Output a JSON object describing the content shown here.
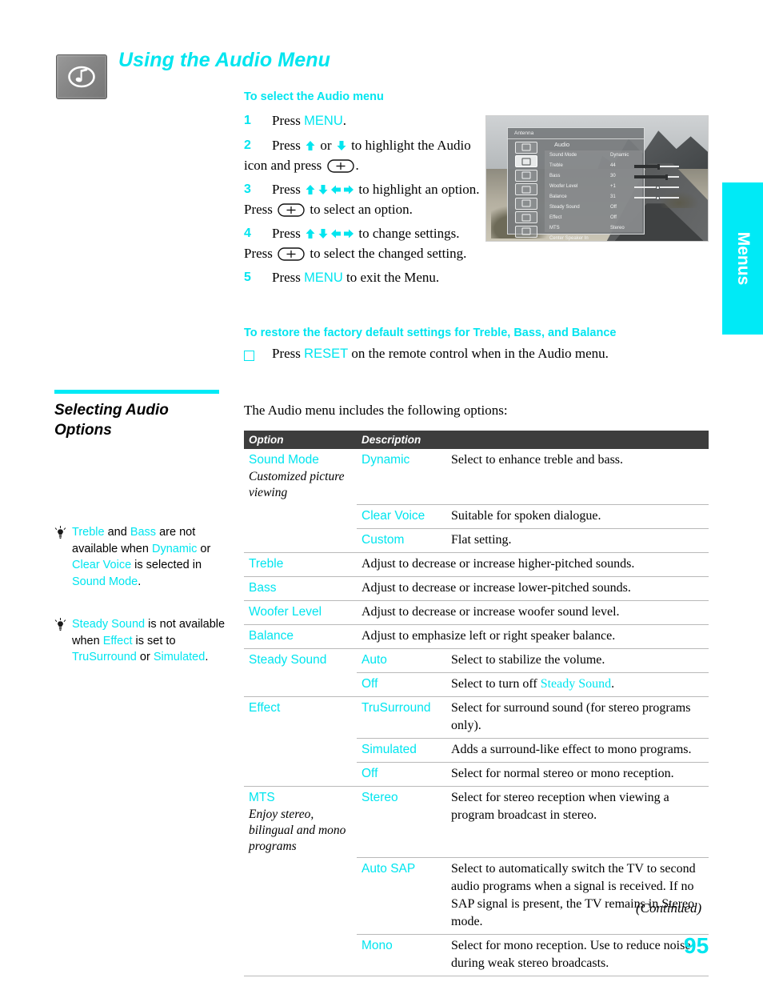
{
  "header": {
    "title": "Using the Audio Menu",
    "icon": "audio-note-icon"
  },
  "procedure": {
    "heading": "To select the Audio menu",
    "steps": [
      {
        "num": "1",
        "parts": [
          {
            "t": "text",
            "v": "Press "
          },
          {
            "t": "key",
            "v": "MENU"
          },
          {
            "t": "text",
            "v": "."
          }
        ]
      },
      {
        "num": "2",
        "parts": [
          {
            "t": "text",
            "v": "Press "
          },
          {
            "t": "arrow",
            "v": "up"
          },
          {
            "t": "text",
            "v": " or "
          },
          {
            "t": "arrow",
            "v": "down"
          },
          {
            "t": "text",
            "v": " to highlight the Audio icon and press "
          },
          {
            "t": "okbtn",
            "v": "center-enter-button"
          },
          {
            "t": "text",
            "v": "."
          }
        ]
      },
      {
        "num": "3",
        "parts": [
          {
            "t": "text",
            "v": "Press "
          },
          {
            "t": "arrow",
            "v": "up"
          },
          {
            "t": "arrow",
            "v": "down"
          },
          {
            "t": "arrow",
            "v": "left"
          },
          {
            "t": "arrow",
            "v": "right"
          },
          {
            "t": "text",
            "v": " to highlight an option. Press "
          },
          {
            "t": "okbtn",
            "v": "center-enter-button"
          },
          {
            "t": "text",
            "v": " to select an option."
          }
        ]
      },
      {
        "num": "4",
        "parts": [
          {
            "t": "text",
            "v": "Press "
          },
          {
            "t": "arrow",
            "v": "up"
          },
          {
            "t": "arrow",
            "v": "down"
          },
          {
            "t": "arrow",
            "v": "left"
          },
          {
            "t": "arrow",
            "v": "right"
          },
          {
            "t": "text",
            "v": " to change settings. Press "
          },
          {
            "t": "okbtn",
            "v": "center-enter-button"
          },
          {
            "t": "text",
            "v": " to select the changed setting."
          }
        ]
      },
      {
        "num": "5",
        "parts": [
          {
            "t": "text",
            "v": "Press "
          },
          {
            "t": "key",
            "v": "MENU"
          },
          {
            "t": "text",
            "v": " to exit the Menu."
          }
        ]
      }
    ]
  },
  "restore": {
    "heading": "To restore the factory default settings for Treble, Bass, and Balance",
    "line_pre": "Press ",
    "line_key": "RESET",
    "line_post": " on the remote control when in the Audio menu."
  },
  "tv_screen": {
    "title_bar": "Antenna",
    "menu_name": "Audio",
    "rows": [
      {
        "label": "Sound Mode",
        "value": "Dynamic",
        "bar": false
      },
      {
        "label": "Treble",
        "value": "44",
        "bar": true,
        "pos": 55,
        "style": "filled"
      },
      {
        "label": "Bass",
        "value": "30",
        "bar": true,
        "pos": 72,
        "style": "filled"
      },
      {
        "label": "Woofer Level",
        "value": "+1",
        "bar": true,
        "pos": 50,
        "style": "open"
      },
      {
        "label": "Balance",
        "value": "31",
        "bar": true,
        "pos": 50,
        "style": "open"
      },
      {
        "label": "Steady Sound",
        "value": "Off",
        "bar": false
      },
      {
        "label": "Effect",
        "value": "Off",
        "bar": false
      },
      {
        "label": "MTS",
        "value": "Stereo",
        "bar": false
      },
      {
        "label": "Center Speaker In",
        "value": "",
        "bar": false
      }
    ]
  },
  "side_tab": {
    "label": "Menus",
    "color": "#00eaf6"
  },
  "left_column": {
    "section_title": "Selecting Audio Options",
    "tips": [
      {
        "icon": "lightbulb-icon",
        "parts": [
          {
            "t": "cy",
            "v": "Treble"
          },
          {
            "t": "k",
            "v": " and "
          },
          {
            "t": "cy",
            "v": "Bass"
          },
          {
            "t": "k",
            "v": " are not available when "
          },
          {
            "t": "cy",
            "v": "Dynamic"
          },
          {
            "t": "k",
            "v": " or "
          },
          {
            "t": "cy",
            "v": "Clear Voice"
          },
          {
            "t": "k",
            "v": " is selected in "
          },
          {
            "t": "cy",
            "v": "Sound Mode"
          },
          {
            "t": "k",
            "v": "."
          }
        ]
      },
      {
        "icon": "lightbulb-icon",
        "parts": [
          {
            "t": "cy",
            "v": "Steady Sound"
          },
          {
            "t": "k",
            "v": " is not available when "
          },
          {
            "t": "cy",
            "v": "Effect"
          },
          {
            "t": "k",
            "v": " is set to "
          },
          {
            "t": "cy",
            "v": "TruSurround"
          },
          {
            "t": "k",
            "v": " or "
          },
          {
            "t": "cy",
            "v": "Simulated"
          },
          {
            "t": "k",
            "v": "."
          }
        ]
      }
    ]
  },
  "intro_line": "The Audio menu includes the following options:",
  "table": {
    "columns": [
      "Option",
      "Description"
    ],
    "rows": [
      {
        "option": "Sound Mode",
        "option_note": "Customized picture viewing",
        "value": "Dynamic",
        "desc": "Select to enhance treble and bass.",
        "first": true
      },
      {
        "option": "",
        "value": "Clear Voice",
        "desc": "Suitable for spoken dialogue.",
        "border": true
      },
      {
        "option": "",
        "value": "Custom",
        "desc": "Flat setting.",
        "border": true
      },
      {
        "option": "Treble",
        "value": "",
        "desc": "Adjust to decrease or increase higher-pitched sounds.",
        "border": true,
        "span": true
      },
      {
        "option": "Bass",
        "value": "",
        "desc": "Adjust to decrease or increase lower-pitched sounds.",
        "border": true,
        "span": true
      },
      {
        "option": "Woofer Level",
        "value": "",
        "desc": "Adjust to decrease or increase woofer sound level.",
        "border": true,
        "span": true
      },
      {
        "option": "Balance",
        "value": "",
        "desc": "Adjust to emphasize left or right speaker balance.",
        "border": true,
        "span": true
      },
      {
        "option": "Steady Sound",
        "value": "Auto",
        "desc": "Select to stabilize the volume.",
        "border": true
      },
      {
        "option": "",
        "value": "Off",
        "desc_pre": "Select to turn off ",
        "desc_cy": "Steady Sound",
        "desc_post": ".",
        "border": true
      },
      {
        "option": "Effect",
        "value": "TruSurround",
        "desc": "Select for surround sound (for stereo programs only).",
        "border": true
      },
      {
        "option": "",
        "value": "Simulated",
        "desc": "Adds a surround-like effect to mono programs.",
        "border": true
      },
      {
        "option": "",
        "value": "Off",
        "desc": "Select for normal stereo or mono reception.",
        "border": true
      },
      {
        "option": "MTS",
        "option_note": "Enjoy stereo, bilingual and mono programs",
        "value": "Stereo",
        "desc": "Select for stereo reception when viewing a program broadcast in stereo.",
        "border": true
      },
      {
        "option": "",
        "value": "Auto SAP",
        "desc": "Select to automatically switch the TV to second audio programs when a signal is received. If no SAP signal is present, the TV remains in Stereo mode.",
        "border": true
      },
      {
        "option": "",
        "value": "Mono",
        "desc": "Select for mono reception. Use to reduce noise during weak stereo broadcasts.",
        "border": true,
        "last": true
      }
    ]
  },
  "footer": {
    "continued": "(Continued)",
    "page_number": "95"
  }
}
